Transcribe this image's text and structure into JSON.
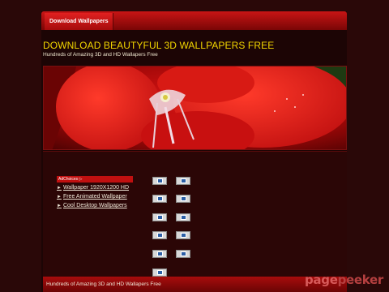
{
  "nav": {
    "tab_label": "Download Wallpapers"
  },
  "header": {
    "title": "DOWNLOAD BEAUTYFUL 3D WALLPAPERS FREE",
    "subtitle": "Hundreds of Amazing 3D and HD Wallapers Free"
  },
  "banner": {
    "subject": "red flower macro photo"
  },
  "ads": {
    "badge": "AdChoices ▷",
    "links": [
      {
        "label": "Wallpaper 1920X1200 HD"
      },
      {
        "label": "Free Animated Wallpaper"
      },
      {
        "label": "Cool Desktop Wallpapers"
      }
    ]
  },
  "thumbnails": {
    "count": 11,
    "icon": "broken-image-icon"
  },
  "footer": {
    "text": "Hundreds of Amazing 3D and HD Wallapers Free"
  },
  "watermark": {
    "part1": "page",
    "part2": "peeker"
  },
  "colors": {
    "background": "#2a0808",
    "accent": "#c81515",
    "title": "#f2d600"
  }
}
